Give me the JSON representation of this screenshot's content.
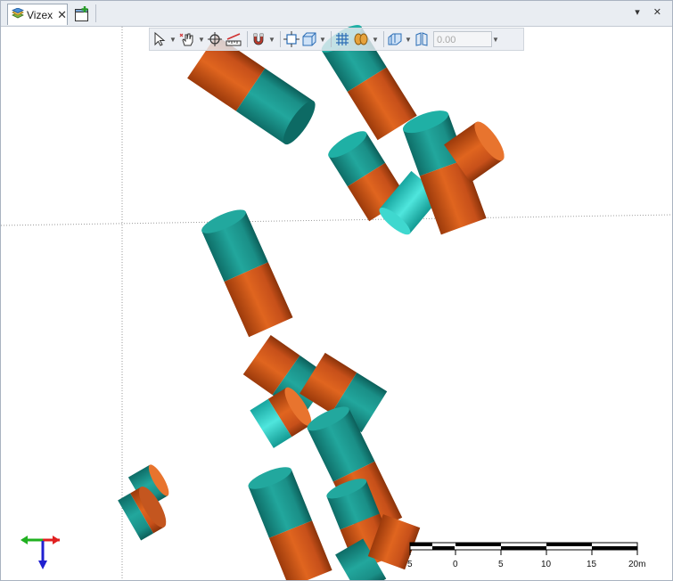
{
  "window": {
    "tab_label": "Vizex",
    "tab_close_glyph": "✕",
    "new_tab_icon": "new-vizex-tab-icon",
    "menu_glyphs": "▾ ✕"
  },
  "toolbar": {
    "tools": [
      {
        "name": "select-arrow-icon"
      },
      {
        "name": "pan-hand-icon"
      },
      {
        "name": "crosshair-icon"
      },
      {
        "name": "measure-icon"
      },
      {
        "name": "snap-magnet-icon"
      },
      {
        "name": "extents-icon"
      },
      {
        "name": "view-box-icon"
      },
      {
        "name": "grid-icon"
      },
      {
        "name": "fly-icon"
      },
      {
        "name": "section-icon"
      },
      {
        "name": "clip-icon"
      }
    ],
    "value_field": "0.00"
  },
  "scale_bar": {
    "labels": [
      "5",
      "0",
      "5",
      "10",
      "15",
      "20m"
    ]
  },
  "colors": {
    "teal": "#1d948c",
    "orange": "#d0561a",
    "axis_x": "#e02020",
    "axis_y": "#20b020",
    "axis_z": "#2020d0"
  }
}
